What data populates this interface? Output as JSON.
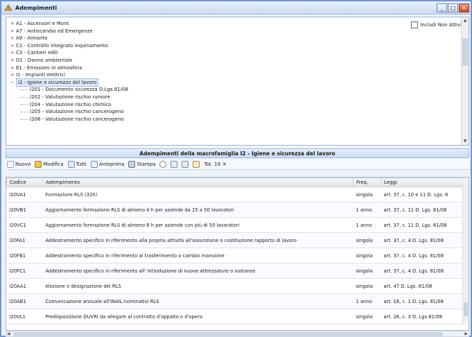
{
  "window": {
    "title": "Adempimenti",
    "buttons": {
      "minimize": "_",
      "maximize": "□",
      "close": "✕"
    }
  },
  "tree": {
    "include_label": "Includi Non Attivi",
    "items": [
      {
        "toggle": "+",
        "label": "A1 - Ascensori e Mont."
      },
      {
        "toggle": "+",
        "label": "A7 - Antincendio ed Emergenze"
      },
      {
        "toggle": "+",
        "label": "A9 - Amianto"
      },
      {
        "toggle": "+",
        "label": "C1 - Controllo integrato inquinamento"
      },
      {
        "toggle": "+",
        "label": "C3 - Cantieri edili"
      },
      {
        "toggle": "+",
        "label": "D1 - Danno ambientale"
      },
      {
        "toggle": "+",
        "label": "E1 - Emissioni in atmosfera"
      },
      {
        "toggle": "+",
        "label": "I1 - Impianti elettrici"
      },
      {
        "toggle": "−",
        "label": "I2 - Igiene e sicurezza del lavoro",
        "selected": true
      }
    ],
    "children": [
      {
        "label": "I201 - Documento sicurezza D.Lgs.81/08"
      },
      {
        "label": "I202 - Valutazione rischio rumore"
      },
      {
        "label": "I204 - Valutazione rischio chimico"
      },
      {
        "label": "I205 - Valutazione rischio cancerogeno"
      },
      {
        "label": "I206 - Valutazione rischio cancerogeno"
      }
    ]
  },
  "section": {
    "title": "Adempimenti della macrofamiglia I2 - Igiene e sicurezza del lavoro"
  },
  "toolbar": {
    "new_label": "Nuovo",
    "edit_label": "Modifica",
    "all_label": "Tutti",
    "preview_label": "Anteprima",
    "print_label": "Stampa",
    "filter_label": "Tot. 19",
    "clear_label": "✕"
  },
  "grid": {
    "columns": [
      "Codice",
      "Adempimento",
      "Freq.",
      "Leggi"
    ],
    "rows": [
      {
        "code": "I20VA1",
        "name": "Formazione RLS (32h)",
        "freq": "singola",
        "law": "art. 37, c. 10 e 11 D. Lgs. 8"
      },
      {
        "code": "I20VB1",
        "name": "Aggiornamento formazione RLS di almeno 4 h per aziende da 15 a 50 lavoratori",
        "freq": "1 anno",
        "law": "art. 37, c. 11 D. Lgs. 81/08"
      },
      {
        "code": "I20VC1",
        "name": "Aggiornamento formazione RLS di almeno 8 h per aziende con più di 50 lavoratori",
        "freq": "1 anno",
        "law": "art. 37, c. 11 D. Lgs. 81/08"
      },
      {
        "code": "I20FA1",
        "name": "Addestramento specifico in riferimento alla propria attività all'assunzione o costituzione rapporto di lavoro",
        "freq": "singola",
        "law": "art. 37, c. 4 D. Lgs. 81/08"
      },
      {
        "code": "I20FB1",
        "name": "Addestramento specifico in riferimento al trasferimento o cambio mansione",
        "freq": "singola",
        "law": "art. 37, c. 4 D. Lgs. 81/08"
      },
      {
        "code": "I20FC1",
        "name": "Addestramento specifico in riferimento all' introduzione di nuove attrezzature o sostanze",
        "freq": "singola",
        "law": "art. 37, c. 4 D. Lgs. 81/08"
      },
      {
        "code": "I20AA1",
        "name": "elezione o designazione del RLS",
        "freq": "singola",
        "law": "art. 47 D. Lgs. 81/08"
      },
      {
        "code": "I20AB1",
        "name": "Comunicazione annuale all'INAIL nominativi RLS",
        "freq": "1 anno",
        "law": "art. 18, c. 1 D. Lgs. 81/08"
      },
      {
        "code": "I20VL1",
        "name": "Predisposizione DUVRI da allegare al contratto d'appalto o d'opera",
        "freq": "singola",
        "law": "art. 26, c. 3 D. Lgs.81/08"
      }
    ]
  },
  "colors": {
    "border": "#6f96d3",
    "header": "#c9dbf5",
    "selected": "#dde9fb"
  }
}
